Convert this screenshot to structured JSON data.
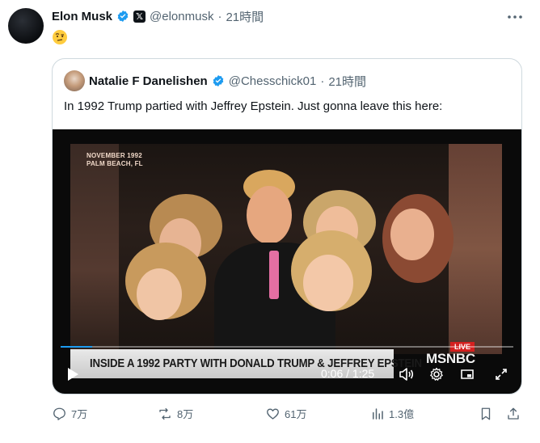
{
  "tweet": {
    "name": "Elon Musk",
    "handle": "@elonmusk",
    "separator": "·",
    "time": "21時間",
    "more": "···",
    "emoji": "face-with-raised-eyebrow"
  },
  "quote": {
    "name": "Natalie F Danelishen",
    "handle": "@Chesschick01",
    "separator": "·",
    "time": "21時間",
    "text": "In 1992 Trump partied with Jeffrey Epstein. Just gonna leave this here:"
  },
  "video": {
    "dateline_line1": "NOVEMBER 1992",
    "dateline_line2": "PALM BEACH, FL",
    "lower_third": "INSIDE A 1992 PARTY WITH DONALD TRUMP & JEFFREY EPSTEIN",
    "live_badge": "LIVE",
    "network": "MSNBC",
    "time_display": "0:06 / 1:25",
    "progress": 0.07
  },
  "actions": {
    "replies": "7万",
    "reposts": "8万",
    "likes": "61万",
    "views": "1.3億"
  },
  "colors": {
    "verified": "#1d9bf0",
    "secondary_text": "#536471",
    "border": "#cfd9de",
    "progress": "#1d9bf0"
  }
}
